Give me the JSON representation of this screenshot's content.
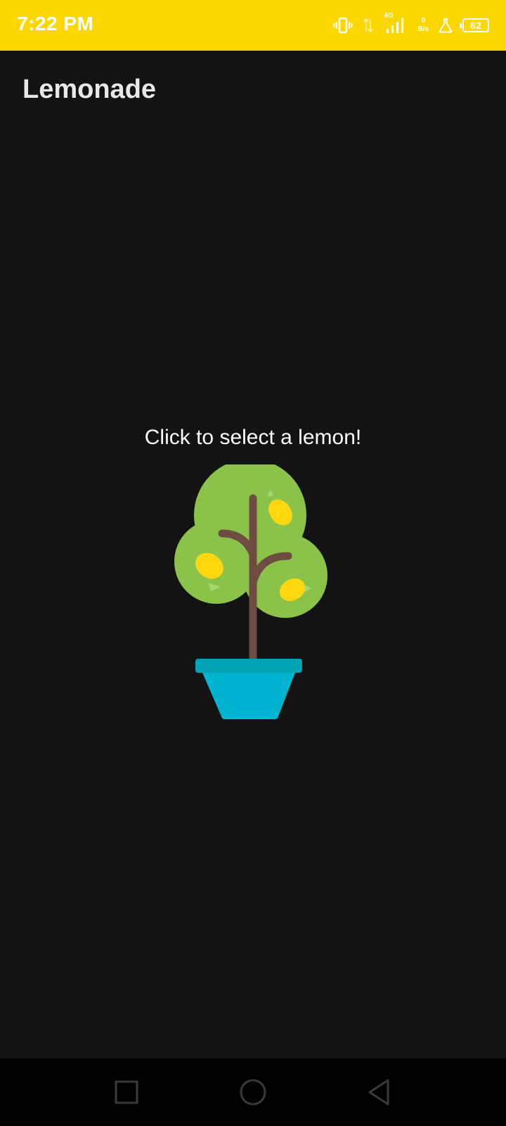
{
  "status_bar": {
    "time": "7:22 PM",
    "network_type": "4G",
    "speed_value": "0",
    "speed_unit": "B/s",
    "battery_level": "62",
    "icons": [
      "vibrate-icon",
      "data-transfer-icon",
      "signal-icon",
      "lab-flask-icon",
      "battery-icon"
    ],
    "background_color": "#FFD700"
  },
  "app": {
    "title": "Lemonade",
    "background_color": "#131313"
  },
  "main": {
    "prompt": "Click to select a lemon!",
    "image": "lemon-tree-image"
  },
  "nav_bar": {
    "icons": [
      "recents-icon",
      "home-icon",
      "back-icon"
    ]
  },
  "colors": {
    "foliage": "#8BC34A",
    "trunk": "#6D4C41",
    "lemon": "#FFD70F",
    "pot": "#00B4CF",
    "pot_rim": "#00A3B5"
  }
}
